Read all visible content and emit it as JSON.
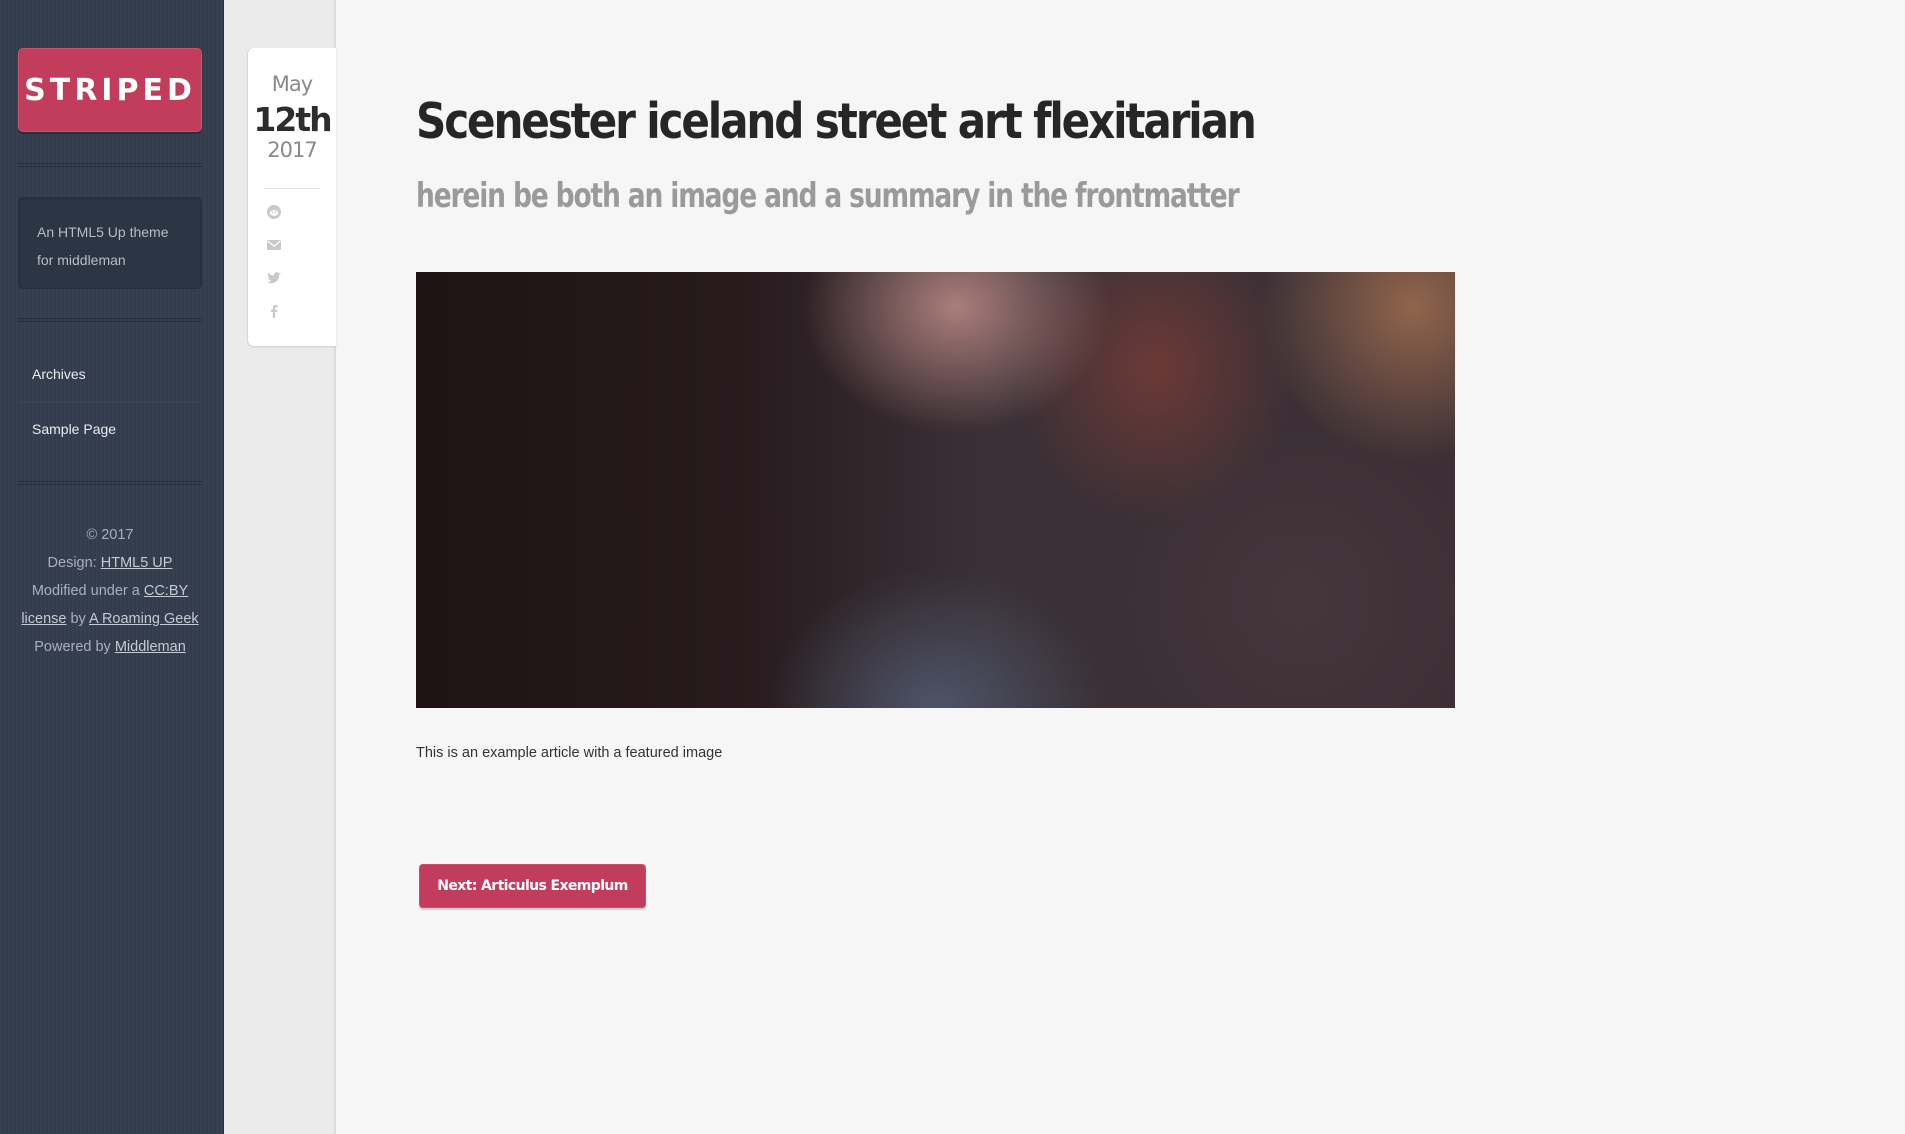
{
  "sidebar": {
    "logo": "STRIPED",
    "about": "An HTML5 Up theme for middleman",
    "nav": [
      {
        "label": "Archives"
      },
      {
        "label": "Sample Page"
      }
    ],
    "footer": {
      "copyright": "© 2017",
      "design_prefix": "Design: ",
      "design_link": "HTML5 UP",
      "modified_prefix": "Modified under a ",
      "license_link_1": "CC:BY",
      "license_link_2": "license",
      "by_text": " by ",
      "author_link": "A Roaming Geek",
      "powered_prefix": "Powered by ",
      "powered_link": "Middleman"
    }
  },
  "post": {
    "date": {
      "month": "May",
      "day": "12th",
      "year": "2017"
    },
    "share_icons": [
      "reddit-icon",
      "email-icon",
      "twitter-icon",
      "facebook-icon"
    ],
    "title": "Scenester iceland street art flexitarian",
    "subtitle": "herein be both an image and a summary in the frontmatter",
    "excerpt": "This is an example article with a featured image",
    "next_label": "Next: Articulus Exemplum"
  },
  "colors": {
    "accent": "#c23d5b",
    "sidebar_bg": "#333d4d",
    "page_bg": "#f6f6f6"
  }
}
